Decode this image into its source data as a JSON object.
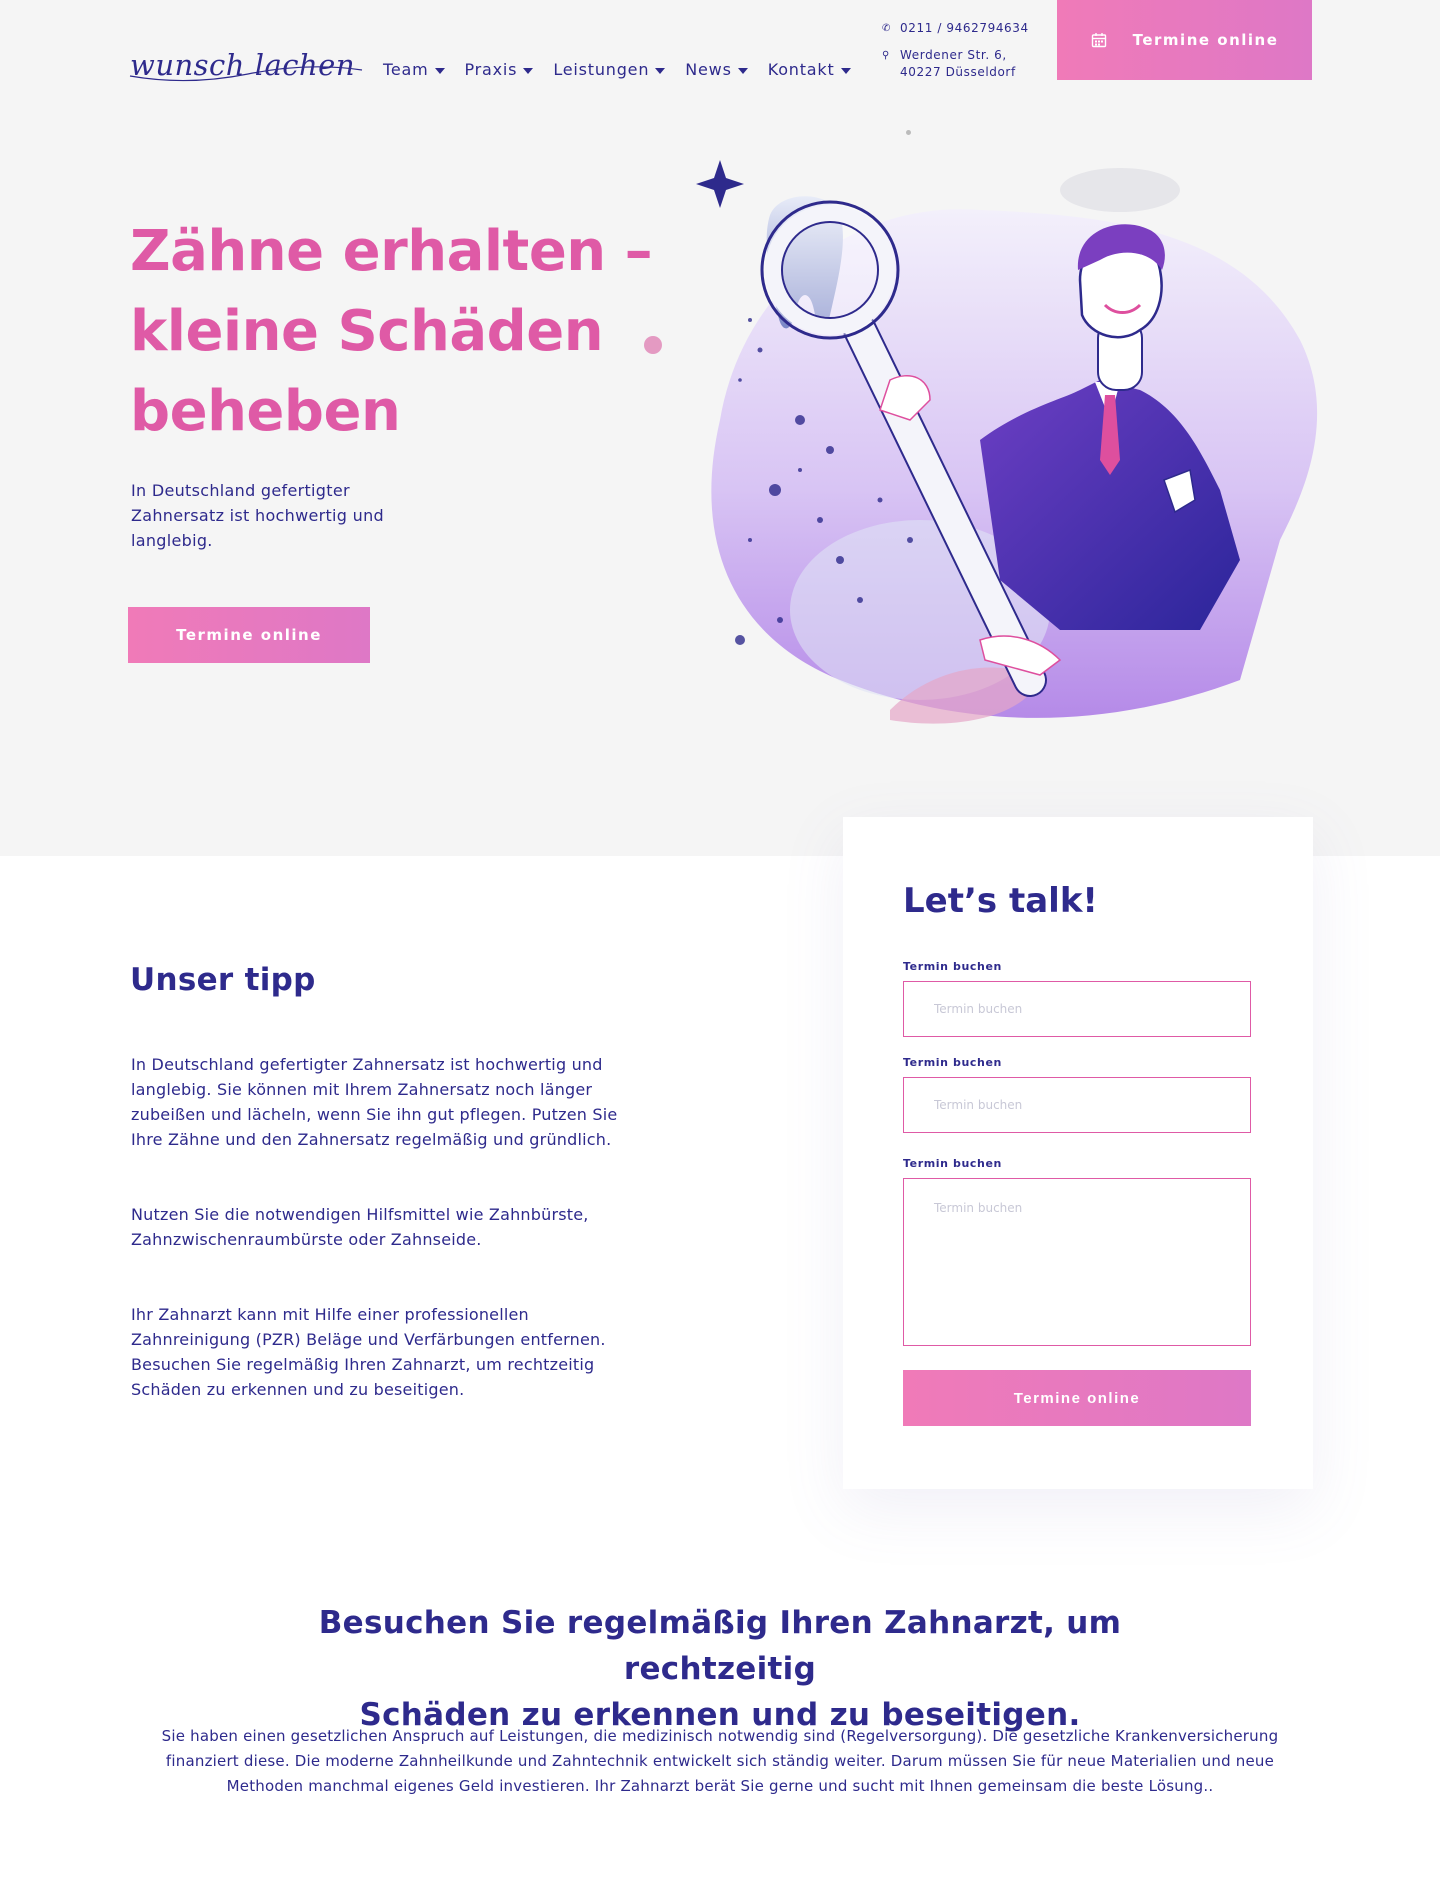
{
  "header": {
    "logo": "wunsch lachen",
    "nav": [
      {
        "label": "Team"
      },
      {
        "label": "Praxis"
      },
      {
        "label": "Leistungen"
      },
      {
        "label": "News"
      },
      {
        "label": "Kontakt"
      }
    ],
    "phone": "0211 / 9462794634",
    "address_line1": "Werdener Str. 6,",
    "address_line2": "40227 Düsseldorf",
    "cta": "Termine online"
  },
  "hero": {
    "title_line1": "Zähne erhalten –",
    "title_line2": "kleine Schäden",
    "title_line3": "beheben",
    "text": "In Deutschland gefertigter Zahnersatz ist hochwertig und langlebig.",
    "cta": "Termine online"
  },
  "tip": {
    "title": "Unser tipp",
    "paragraphs": [
      "In Deutschland gefertigter Zahnersatz ist hochwertig und langlebig. Sie können mit Ihrem Zahnersatz noch länger zubeißen und lächeln, wenn Sie ihn gut pflegen. Putzen Sie Ihre Zähne  und den Zahnersatz regelmäßig und gründlich.",
      "Nutzen Sie die notwendigen Hilfsmittel wie Zahnbürste, Zahnzwischenraumbürste oder Zahnseide.",
      "Ihr Zahnarzt kann mit Hilfe einer  professionellen Zahnreinigung (PZR) Beläge und Verfärbungen  entfernen. Besuchen Sie regelmäßig Ihren Zahnarzt, um rechtzeitig Schäden zu erkennen und zu beseitigen."
    ]
  },
  "form": {
    "title": "Let’s talk!",
    "fields": [
      {
        "label": "Termin buchen",
        "placeholder": "Termin buchen",
        "value": ""
      },
      {
        "label": "Termin buchen",
        "placeholder": "Termin buchen",
        "value": ""
      },
      {
        "label": "Termin buchen",
        "placeholder": "Termin buchen",
        "value": ""
      }
    ],
    "submit": "Termine online"
  },
  "bottom": {
    "title_line1": "Besuchen Sie regelmäßig Ihren Zahnarzt, um rechtzeitig",
    "title_line2": "Schäden zu erkennen und zu beseitigen.",
    "text": "Sie haben einen gesetzlichen Anspruch auf Leistungen, die medizinisch notwendig sind (Regelversorgung). Die gesetzliche Krankenversicherung finanziert diese.  Die moderne Zahnheilkunde und Zahntechnik entwickelt sich ständig weiter. Darum müssen Sie für  neue Materialien und neue Methoden manchmal  eigenes Geld investieren.  Ihr Zahnarzt berät Sie gerne und sucht  mit Ihnen gemeinsam die beste Lösung.."
  },
  "colors": {
    "brand_navy": "#2e2a8c",
    "brand_pink": "#df5aa6",
    "button_gradient_start": "#f07ab8",
    "button_gradient_end": "#de78c6",
    "hero_background": "#f5f5f5"
  },
  "icons": {
    "phone": "phone-icon",
    "location": "location-pin-icon",
    "calendar": "calendar-icon"
  }
}
